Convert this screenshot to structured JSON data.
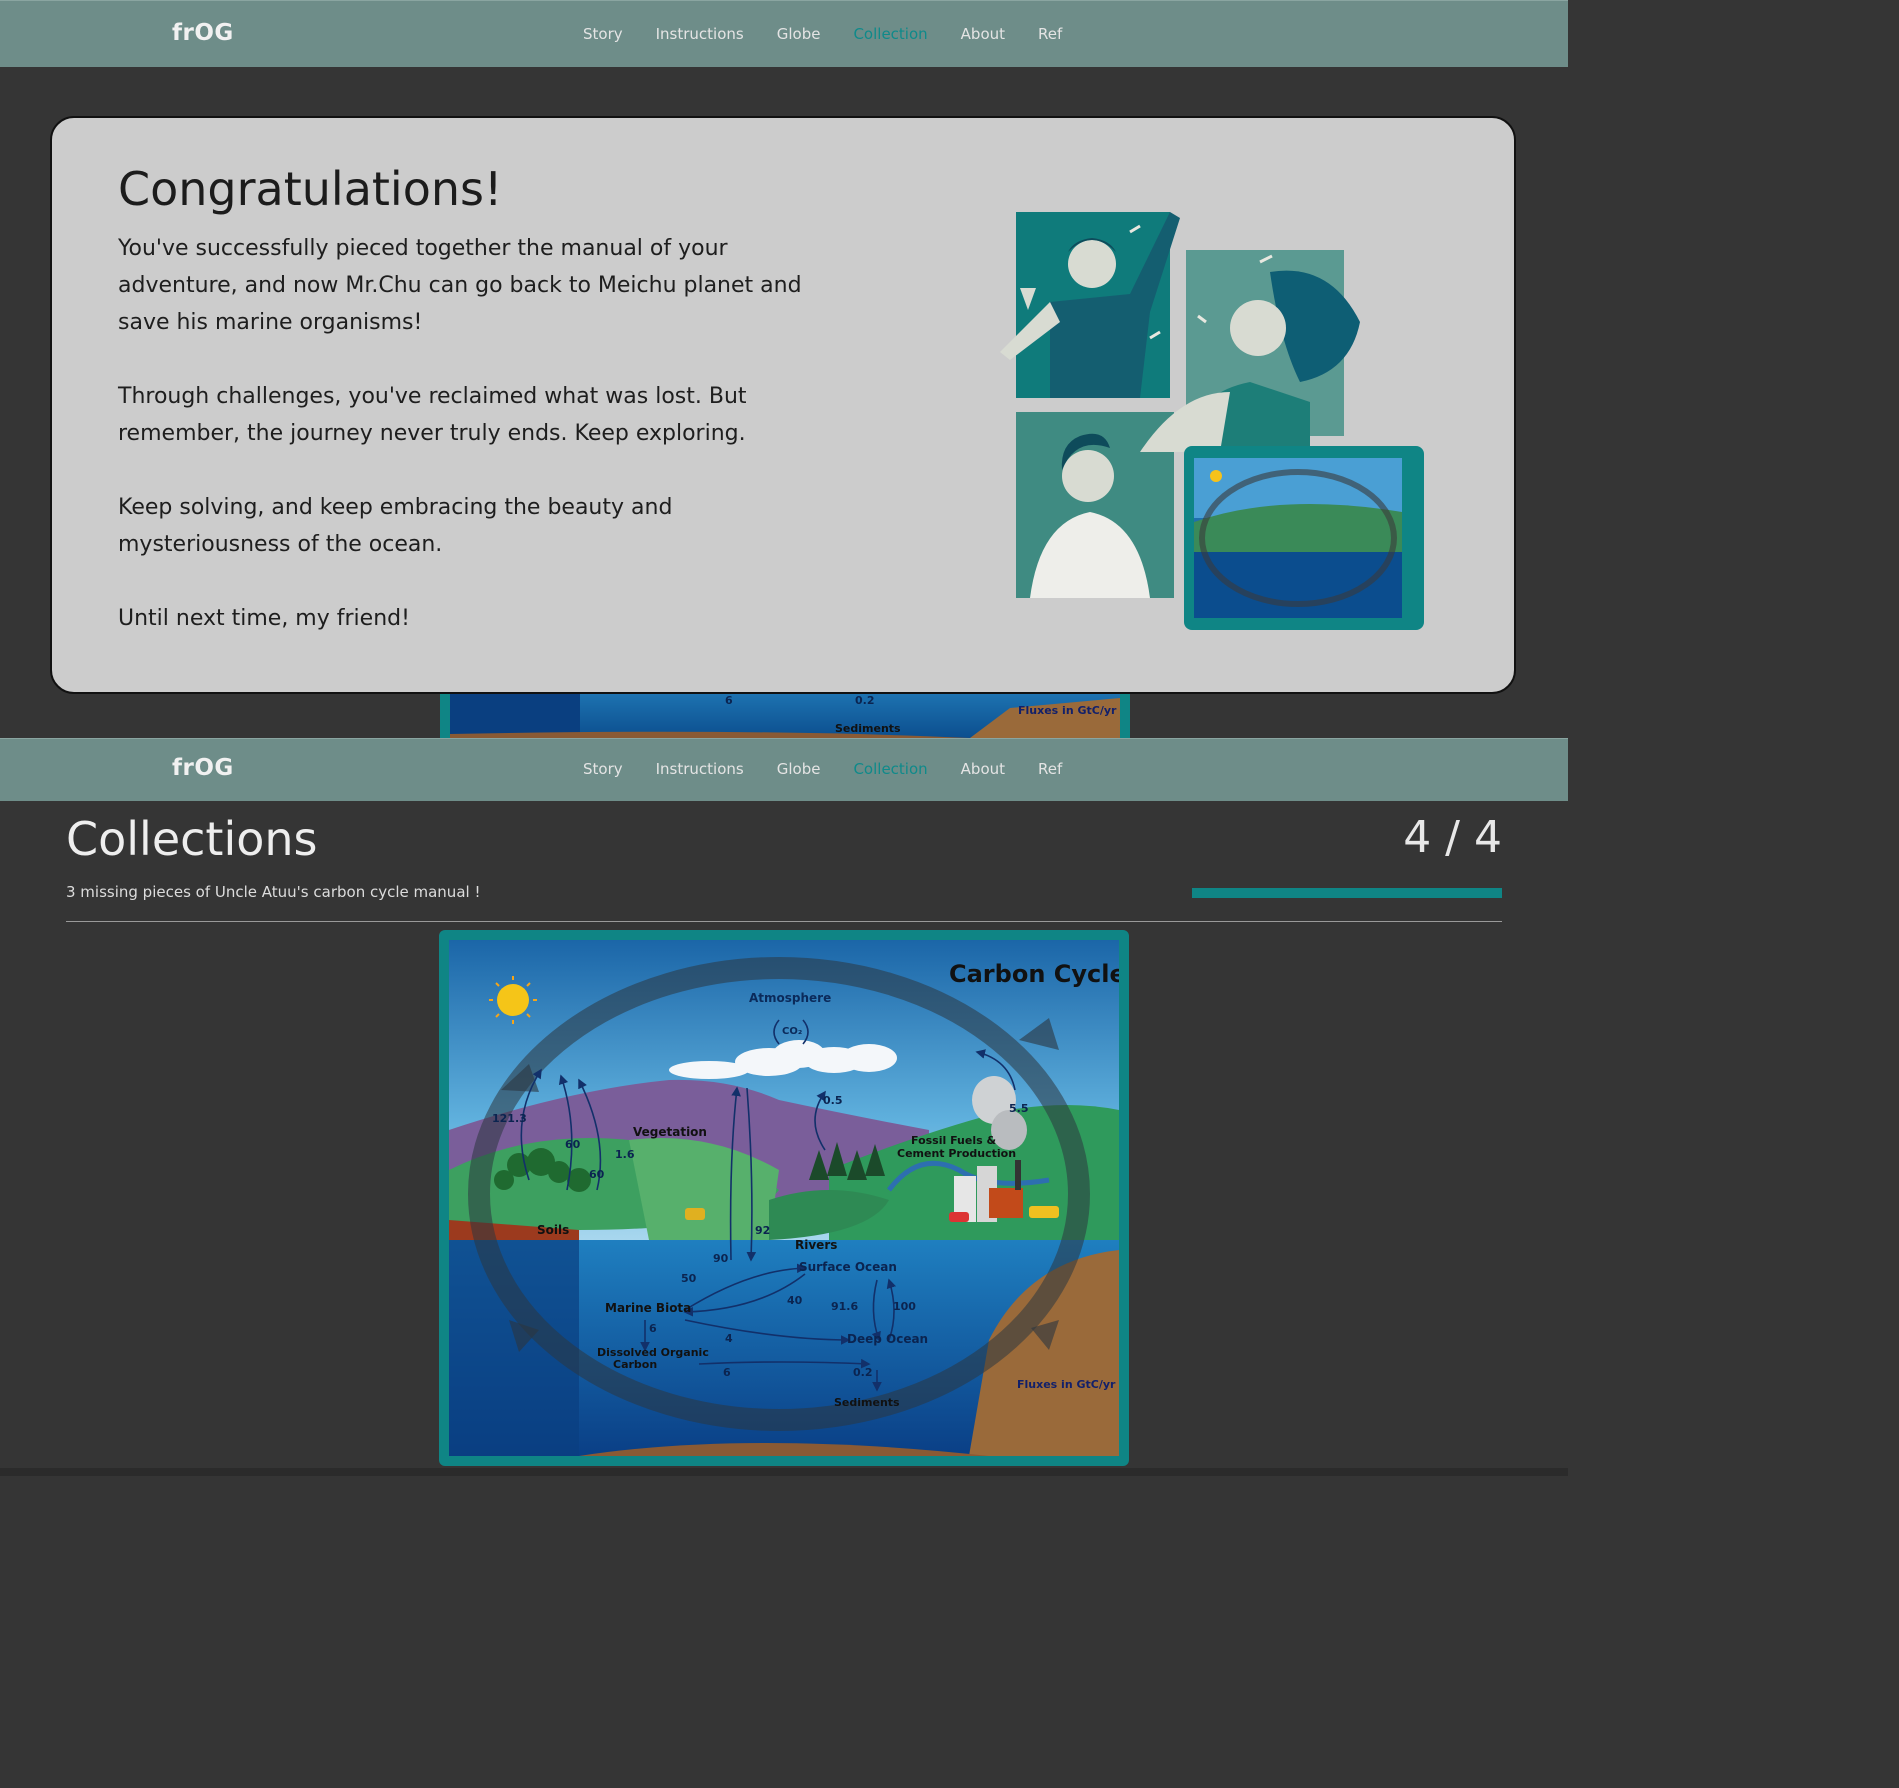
{
  "nav": {
    "brand": "frOG",
    "links": [
      "Story",
      "Instructions",
      "Globe",
      "Collection",
      "About",
      "Ref"
    ],
    "active": "Collection"
  },
  "modal": {
    "title": "Congratulations!",
    "paragraphs": [
      "You've successfully pieced together the manual of your adventure, and now Mr.Chu can go back to Meichu planet and save his marine organisms!",
      "Through challenges, you've reclaimed what was lost. But remember, the journey never truly ends. Keep exploring.",
      "Keep solving, and keep embracing the beauty and mysteriousness of the ocean.",
      "Until next time, my friend!"
    ]
  },
  "collections": {
    "title": "Collections",
    "count": "4 / 4",
    "subtitle": "3 missing pieces of Uncle Atuu's carbon cycle manual !",
    "progress": 1.0
  },
  "diagram": {
    "title": "Carbon Cycle",
    "atmosphere": "Atmosphere",
    "co2": "CO₂",
    "vegetation": "Vegetation",
    "soils": "Soils",
    "fossil": [
      "Fossil Fuels &",
      "Cement Production"
    ],
    "rivers": "Rivers",
    "surface_ocean": "Surface Ocean",
    "marine_biota": "Marine Biota",
    "deep_ocean": "Deep Ocean",
    "doc": [
      "Dissolved Organic",
      "Carbon"
    ],
    "sediments": "Sediments",
    "fluxes": "Fluxes in GtC/yr",
    "values": {
      "v121": "121.3",
      "v60a": "60",
      "v60b": "60",
      "v16": "1.6",
      "v05": "0.5",
      "v55": "5.5",
      "v92": "92",
      "v90": "90",
      "v50": "50",
      "v40": "40",
      "v916": "91.6",
      "v100": "100",
      "v6a": "6",
      "v4": "4",
      "v6b": "6",
      "v02": "0.2"
    }
  },
  "peek": {
    "sediments": "Sediments",
    "fluxes": "Fluxes in GtC/yr",
    "v6": "6",
    "v02": "0.2"
  },
  "colors": {
    "nav": "#6e8d89",
    "accent": "#0f8585",
    "background": "#353535",
    "modal": "#cccccc"
  }
}
